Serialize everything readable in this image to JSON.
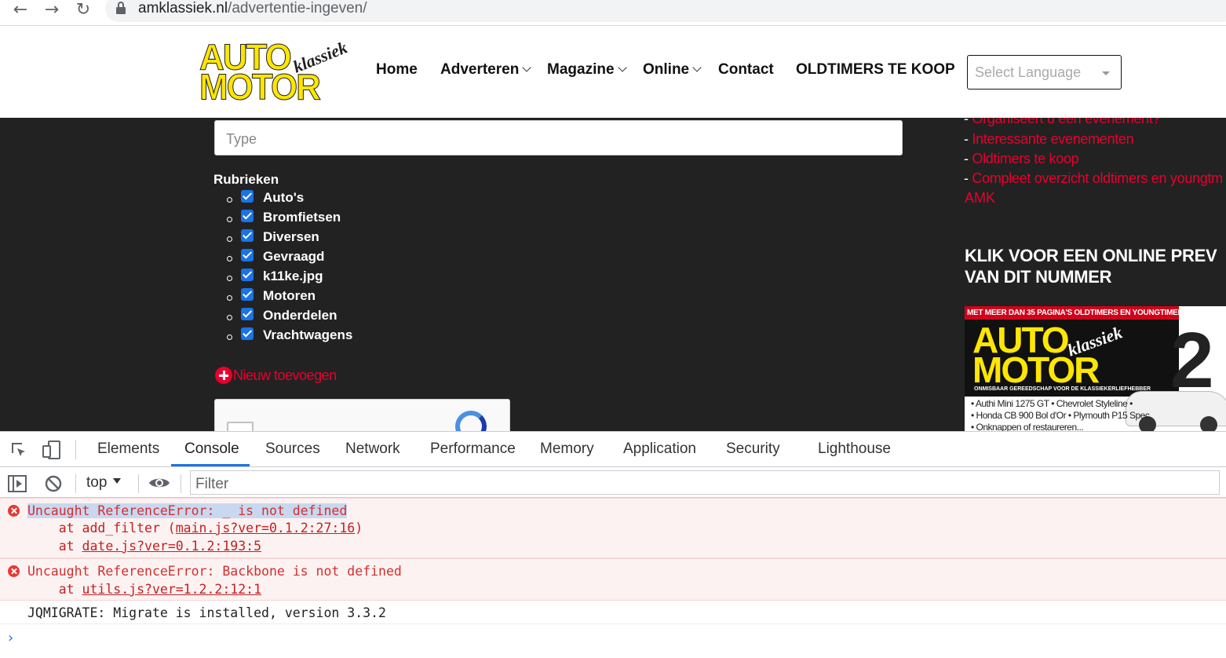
{
  "browser": {
    "url_domain": "amklassiek.nl",
    "url_path": "/advertentie-ingeven/",
    "back_glyph": "←",
    "forward_glyph": "→",
    "reload_glyph": "↻"
  },
  "header": {
    "logo": {
      "line1": "AUTO",
      "line2": "MOTOR",
      "script": "klassiek"
    },
    "nav": [
      {
        "label": "Home",
        "dropdown": false
      },
      {
        "label": "Adverteren",
        "dropdown": true
      },
      {
        "label": "Magazine",
        "dropdown": true
      },
      {
        "label": "Online",
        "dropdown": true
      },
      {
        "label": "Contact",
        "dropdown": false
      },
      {
        "label": "OLDTIMERS TE KOOP",
        "dropdown": false
      }
    ],
    "language_select": {
      "placeholder": "Select Language"
    }
  },
  "form": {
    "type_placeholder": "Type",
    "rubrieken_title": "Rubrieken",
    "rubrieken": [
      {
        "label": "Auto's",
        "checked": true
      },
      {
        "label": "Bromfietsen",
        "checked": true
      },
      {
        "label": "Diversen",
        "checked": true
      },
      {
        "label": "Gevraagd",
        "checked": true
      },
      {
        "label": "k11ke.jpg",
        "checked": true
      },
      {
        "label": "Motoren",
        "checked": true
      },
      {
        "label": "Onderdelen",
        "checked": true
      },
      {
        "label": "Vrachtwagens",
        "checked": true
      }
    ],
    "add_new_label": "Nieuw toevoegen"
  },
  "sidebar": {
    "links": [
      {
        "prefix": "- ",
        "text": "Organiseert u een evenement?"
      },
      {
        "prefix": "- ",
        "text": "Interessante evenementen"
      },
      {
        "prefix": "- ",
        "text": "Oldtimers te koop"
      },
      {
        "prefix": "- ",
        "text": "Compleet overzicht oldtimers en youngtm"
      }
    ],
    "amk": "AMK",
    "heading_line1": "KLIK VOOR EEN ONLINE PREV",
    "heading_line2": "VAN DIT NUMMER",
    "cover": {
      "banner": "MET MEER DAN 35 PAGINA'S OLDTIMERS EN YOUNGTIMERS TE KOOP",
      "title1": "AUTO",
      "title2": "MOTOR",
      "script": "klassiek",
      "subtitle": "ONMISBAAR GEREEDSCHAP VOOR DE KLASSIEKERLIEFHEBBER",
      "issue": "2",
      "line1": "• Authi Mini 1275 GT • Chevrolet Styleline •",
      "line2": "• Honda CB 900 Bol d'Or • Plymouth P15 Spec",
      "line3": "• Onknappen of restaureren..."
    }
  },
  "devtools": {
    "tabs": [
      "Elements",
      "Console",
      "Sources",
      "Network",
      "Performance",
      "Memory",
      "Application",
      "Security",
      "Lighthouse"
    ],
    "active_tab": "Console",
    "context": "top",
    "filter_placeholder": "Filter",
    "messages": [
      {
        "level": "error",
        "text_before": "Uncaught ReferenceError: _ is not defined",
        "stack": [
          {
            "prefix": "    at add_filter (",
            "link": "main.js?ver=0.1.2:27:16",
            "suffix": ")"
          },
          {
            "prefix": "    at ",
            "link": "date.js?ver=0.1.2:193:5",
            "suffix": ""
          }
        ]
      },
      {
        "level": "error",
        "text_before": "Uncaught ReferenceError: Backbone is not defined",
        "stack": [
          {
            "prefix": "    at ",
            "link": "utils.js?ver=1.2.2:12:1",
            "suffix": ""
          }
        ]
      },
      {
        "level": "log",
        "text_before": "JQMIGRATE: Migrate is installed, version 3.3.2"
      }
    ],
    "prompt_glyph": "›"
  }
}
